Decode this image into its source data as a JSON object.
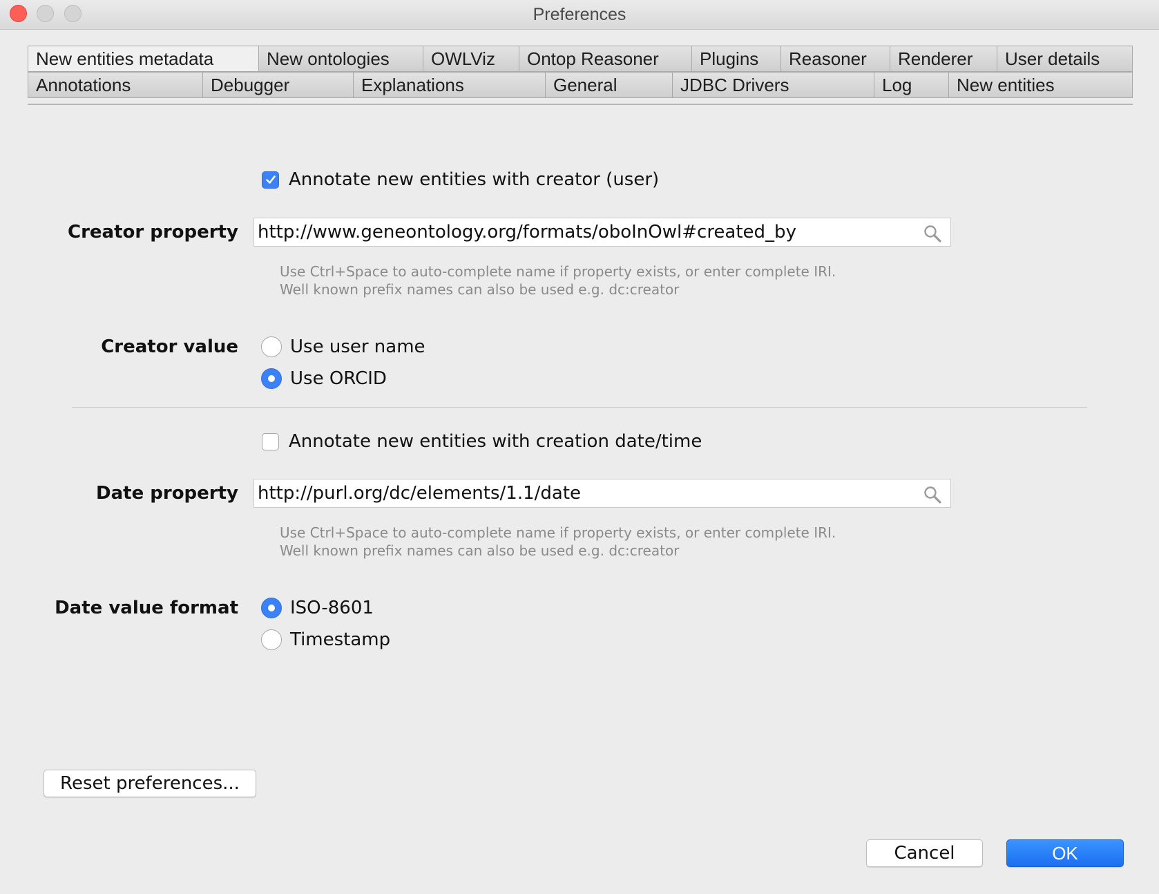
{
  "window": {
    "title": "Preferences"
  },
  "tabs": {
    "row1": [
      "New entities metadata",
      "New ontologies",
      "OWLViz",
      "Ontop Reasoner",
      "Plugins",
      "Reasoner",
      "Renderer",
      "User details"
    ],
    "row2": [
      "Annotations",
      "Debugger",
      "Explanations",
      "General",
      "JDBC Drivers",
      "Log",
      "New entities"
    ],
    "active": "New entities metadata"
  },
  "creator": {
    "annotate_label": "Annotate new entities with creator (user)",
    "annotate_checked": true,
    "property_label": "Creator property",
    "property_value": "http://www.geneontology.org/formats/oboInOwl#created_by",
    "hint_line1": "Use Ctrl+Space to auto-complete name if property exists, or enter complete IRI.",
    "hint_line2": "Well known prefix names can also be used e.g. dc:creator",
    "value_label": "Creator value",
    "options": [
      "Use user name",
      "Use ORCID"
    ],
    "selected": "Use ORCID"
  },
  "date": {
    "annotate_label": "Annotate new entities with creation date/time",
    "annotate_checked": false,
    "property_label": "Date property",
    "property_value": "http://purl.org/dc/elements/1.1/date",
    "hint_line1": "Use Ctrl+Space to auto-complete name if property exists, or enter complete IRI.",
    "hint_line2": "Well known prefix names can also be used e.g. dc:creator",
    "format_label": "Date value format",
    "options": [
      "ISO-8601",
      "Timestamp"
    ],
    "selected": "ISO-8601"
  },
  "buttons": {
    "reset": "Reset preferences...",
    "cancel": "Cancel",
    "ok": "OK"
  },
  "colors": {
    "accent": "#3b82f6",
    "close": "#ff5f57"
  },
  "icons": {
    "search": "search-icon",
    "check": "checkmark-icon"
  }
}
